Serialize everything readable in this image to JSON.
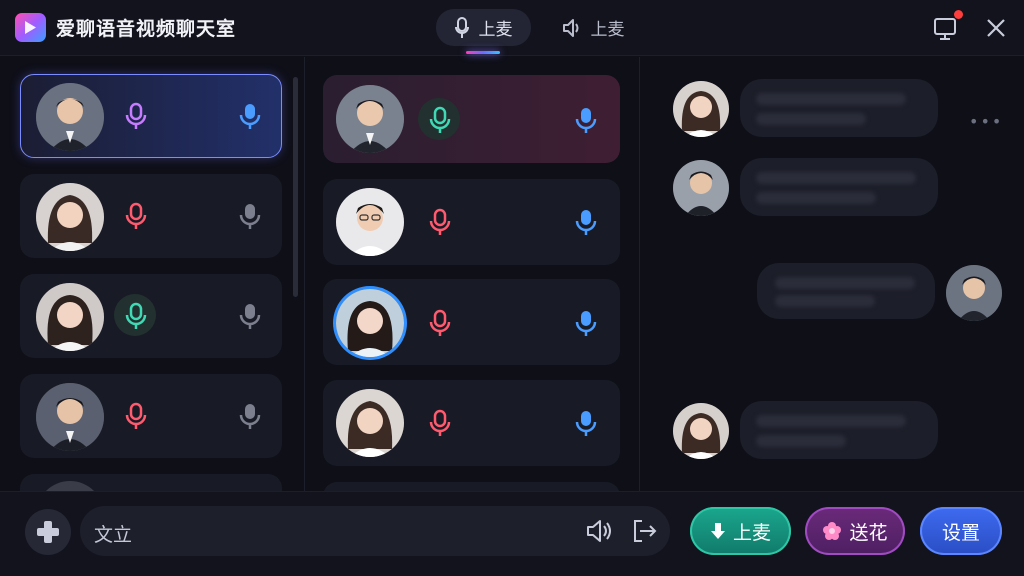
{
  "app": {
    "title": "爱聊语音视频聊天室",
    "logo_icon": "app-logo-icon"
  },
  "tabs": [
    {
      "label": "上麦",
      "icon": "mic-icon",
      "active": true
    },
    {
      "label": "上麦",
      "icon": "speaker-icon",
      "active": false
    }
  ],
  "colors": {
    "accent_pink": "#ff3fb4",
    "accent_blue": "#33c3ff",
    "mic_purple": "#c77bff",
    "mic_red": "#ff5a6e",
    "mic_green": "#3fd9b5",
    "mic_blue": "#4a9cff",
    "mic_gray": "#7c7f8e"
  },
  "left_column": {
    "cards": [
      {
        "avatar": "male-avatar",
        "active": true,
        "left_mic": "purple",
        "right_mic": "blue"
      },
      {
        "avatar": "female-avatar",
        "active": false,
        "left_mic": "red",
        "right_mic": "gray"
      },
      {
        "avatar": "female-avatar",
        "active": false,
        "left_mic": "green",
        "right_mic": "gray"
      },
      {
        "avatar": "male-avatar",
        "active": false,
        "left_mic": "red",
        "right_mic": "gray"
      }
    ]
  },
  "middle_column": {
    "cards": [
      {
        "avatar": "male-avatar",
        "active": true,
        "left_mic": "green",
        "right_mic": "blue"
      },
      {
        "avatar": "male-avatar",
        "active": false,
        "left_mic": "red",
        "right_mic": "blue"
      },
      {
        "avatar": "female-avatar",
        "active": false,
        "left_mic": "red",
        "right_mic": "blue",
        "ring": true
      },
      {
        "avatar": "female-avatar",
        "active": false,
        "left_mic": "red",
        "right_mic": "blue"
      }
    ]
  },
  "chat": {
    "more_icon": "more-icon"
  },
  "bottom": {
    "input_value": "文立",
    "plus_icon": "plus-icon",
    "volume_icon": "volume-icon",
    "exit_icon": "exit-icon",
    "btn_shangmai": "上麦",
    "btn_flower": "送花",
    "btn_settings": "设置"
  }
}
